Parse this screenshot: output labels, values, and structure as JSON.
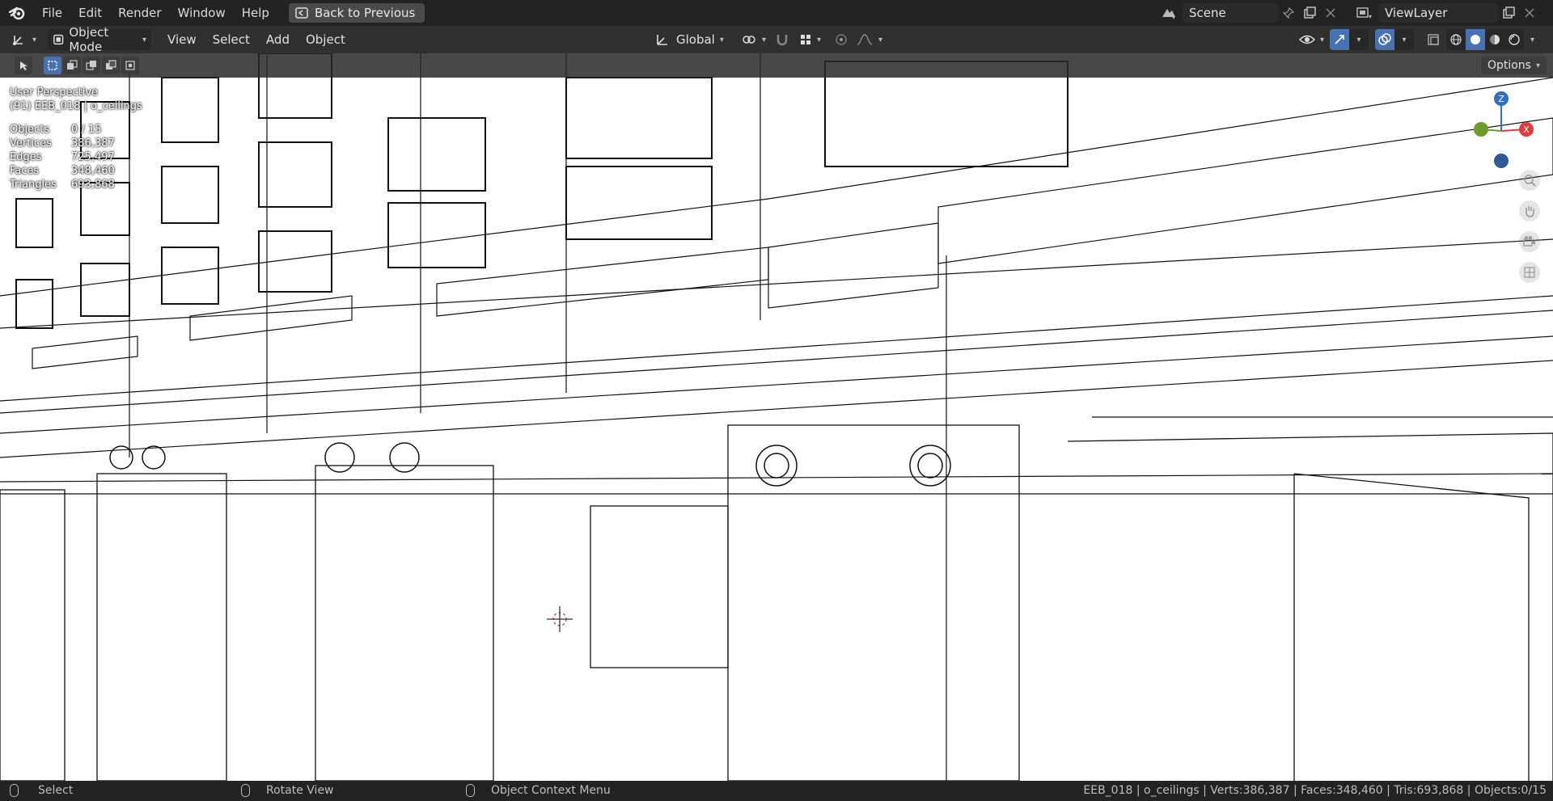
{
  "menubar": {
    "items": [
      "File",
      "Edit",
      "Render",
      "Window",
      "Help"
    ],
    "back_button": "Back to Previous",
    "scene_name": "Scene",
    "view_layer": "ViewLayer"
  },
  "header": {
    "mode": "Object Mode",
    "menus": [
      "View",
      "Select",
      "Add",
      "Object"
    ],
    "orientation": "Global",
    "options_label": "Options"
  },
  "viewport": {
    "view_name": "User Perspective",
    "collection_info": "(91) EEB_018 | o_ceilings",
    "stats": [
      {
        "label": "Objects",
        "value": "0 / 15"
      },
      {
        "label": "Vertices",
        "value": "386,387"
      },
      {
        "label": "Edges",
        "value": "725,497"
      },
      {
        "label": "Faces",
        "value": "348,460"
      },
      {
        "label": "Triangles",
        "value": "693,868"
      }
    ],
    "gizmo": {
      "z": "Z",
      "x": "X"
    }
  },
  "statusbar": {
    "select": "Select",
    "rotate": "Rotate View",
    "context": "Object Context Menu",
    "info": "EEB_018 | o_ceilings | Verts:386,387 | Faces:348,460 | Tris:693,868 | Objects:0/15"
  },
  "colors": {
    "accent": "#4772b3",
    "axis_x": "#e03b3b",
    "axis_y": "#6f9a2c",
    "axis_z": "#2f6fc4"
  }
}
